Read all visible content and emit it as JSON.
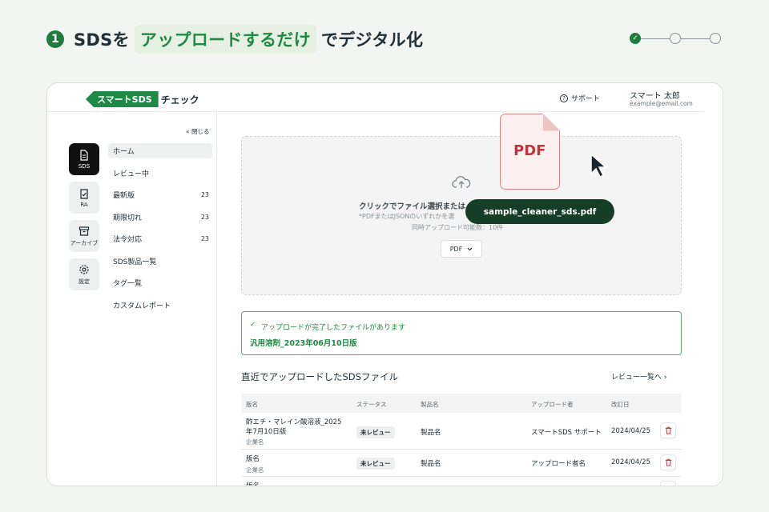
{
  "headline": {
    "step_number": "1",
    "prefix": "SDSを",
    "highlight": "アップロードするだけ",
    "suffix": "でデジタル化"
  },
  "stepper": {
    "done_mark": "✓"
  },
  "header": {
    "logo_tag": "スマートSDS",
    "logo_text": "チェック",
    "support_label": "サポート",
    "user_name": "スマート 太郎",
    "user_email": "example@email.com"
  },
  "rail": [
    {
      "label": "SDS"
    },
    {
      "label": "RA"
    },
    {
      "label": "アーカイブ"
    },
    {
      "label": "設定"
    }
  ],
  "nav": {
    "close_label": "« 閉じる",
    "items": [
      {
        "label": "ホーム",
        "count": ""
      },
      {
        "label": "レビュー中",
        "count": ""
      },
      {
        "label": "最新版",
        "count": "23"
      },
      {
        "label": "期限切れ",
        "count": "23"
      },
      {
        "label": "法令対応",
        "count": "23"
      },
      {
        "label": "SDS製品一覧",
        "count": ""
      },
      {
        "label": "タグ一覧",
        "count": ""
      },
      {
        "label": "カスタムレポート",
        "count": ""
      }
    ]
  },
  "upload": {
    "main_text": "クリックでファイル選択または",
    "sub_text_1": "*PDFまたはJSONのいずれかを選",
    "sub_text_2": "同時アップロード可能数：10件",
    "format_select": "PDF",
    "dragging_file": "sample_cleaner_sds.pdf",
    "pdf_label": "PDF"
  },
  "alert": {
    "title": "アップロードが完了したファイルがあります",
    "file": "汎用溶剤_2023年06月10日版"
  },
  "recent": {
    "title": "直近でアップロードしたSDSファイル",
    "link": "レビュー一覧へ ›",
    "columns": [
      "版名",
      "ステータス",
      "製品名",
      "アップロード者",
      "改訂日"
    ],
    "rows": [
      {
        "name_line1": "酢エチ・マレイン酸溶液_2025",
        "name_line2": "年7月10日版",
        "company": "企業名",
        "status": "未レビュー",
        "product": "製品名",
        "uploader": "スマートSDS サポート",
        "date": "2024/04/25"
      },
      {
        "name_line1": "版名",
        "name_line2": "",
        "company": "企業名",
        "status": "未レビュー",
        "product": "製品名",
        "uploader": "アップロード者名",
        "date": "2024/04/25"
      },
      {
        "name_line1": "版名",
        "name_line2": "",
        "company": "",
        "status": "",
        "product": "",
        "uploader": "",
        "date": ""
      }
    ]
  },
  "colors": {
    "brand_green": "#1e8a43",
    "pill_dark": "#163d28",
    "pdf_red": "#c1353a",
    "delete_red": "#d2333a"
  },
  "icons": [
    "check-icon",
    "support-icon",
    "document-icon",
    "clipboard-check-icon",
    "archive-icon",
    "gear-icon",
    "cloud-upload-icon",
    "chevron-down-icon",
    "chevron-right-icon",
    "cursor-icon",
    "trash-icon"
  ]
}
